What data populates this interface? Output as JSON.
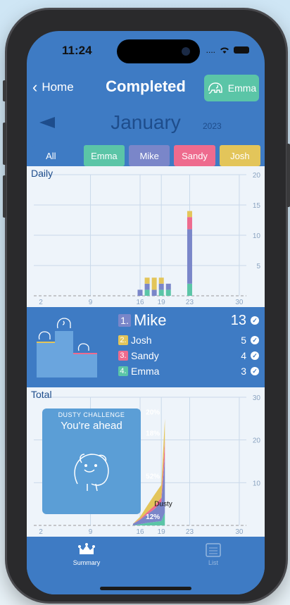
{
  "status": {
    "time": "11:24",
    "signal": "....",
    "wifi_icon": "wifi-icon",
    "battery_icon": "battery-icon"
  },
  "nav": {
    "back_label": "Home",
    "title": "Completed",
    "user_label": "Emma"
  },
  "month": {
    "name": "January",
    "year": "2023"
  },
  "filters": [
    {
      "label": "All",
      "color": "#3e7bc4"
    },
    {
      "label": "Emma",
      "color": "#5bc5a7"
    },
    {
      "label": "Mike",
      "color": "#7a86c9"
    },
    {
      "label": "Sandy",
      "color": "#ee6b8e"
    },
    {
      "label": "Josh",
      "color": "#e3c55a"
    }
  ],
  "daily": {
    "label": "Daily",
    "y_ticks": [
      "20",
      "15",
      "10",
      "5"
    ],
    "x_ticks": [
      "2",
      "9",
      "16",
      "19",
      "23",
      "30"
    ]
  },
  "ranking": [
    {
      "rank": "1.",
      "name": "Mike",
      "count": "13",
      "color": "#7a86c9"
    },
    {
      "rank": "2.",
      "name": "Josh",
      "count": "5",
      "color": "#e3c55a"
    },
    {
      "rank": "3.",
      "name": "Sandy",
      "count": "4",
      "color": "#ee6b8e"
    },
    {
      "rank": "4.",
      "name": "Emma",
      "count": "3",
      "color": "#5bc5a7"
    }
  ],
  "total": {
    "label": "Total",
    "y_ticks": [
      "30",
      "20",
      "10"
    ],
    "x_ticks": [
      "2",
      "9",
      "16",
      "19",
      "23",
      "30"
    ],
    "pct_labels": [
      "20%",
      "18%",
      "52%",
      "12%"
    ],
    "marker_label": "Dusty"
  },
  "challenge": {
    "title": "DUSTY CHALLENGE",
    "message": "You're ahead"
  },
  "tabs": {
    "summary_label": "Summary",
    "list_label": "List"
  },
  "colors": {
    "emma": "#5bc5a7",
    "mike": "#7a86c9",
    "sandy": "#ee6b8e",
    "josh": "#e3c55a",
    "brand": "#3e7bc4"
  },
  "chart_data": [
    {
      "type": "bar",
      "title": "Daily",
      "x": [
        "16",
        "17",
        "18",
        "19",
        "20",
        "21",
        "22",
        "23"
      ],
      "series": [
        {
          "name": "Mike",
          "values": [
            1,
            1,
            1,
            1,
            1,
            0,
            0,
            9
          ]
        },
        {
          "name": "Josh",
          "values": [
            0,
            1,
            2,
            1,
            0,
            0,
            0,
            1
          ]
        },
        {
          "name": "Sandy",
          "values": [
            0,
            0,
            0,
            0,
            0,
            0,
            0,
            2
          ]
        },
        {
          "name": "Emma",
          "values": [
            0,
            1,
            0,
            1,
            1,
            0,
            0,
            2
          ]
        }
      ],
      "ylim": [
        0,
        20
      ]
    },
    {
      "type": "area",
      "title": "Total",
      "x": [
        1,
        30
      ],
      "ylim": [
        0,
        30
      ],
      "stack_pct": {
        "Josh": "20%",
        "Sandy": "18%",
        "Mike": "52%",
        "Emma": "12%"
      }
    }
  ]
}
